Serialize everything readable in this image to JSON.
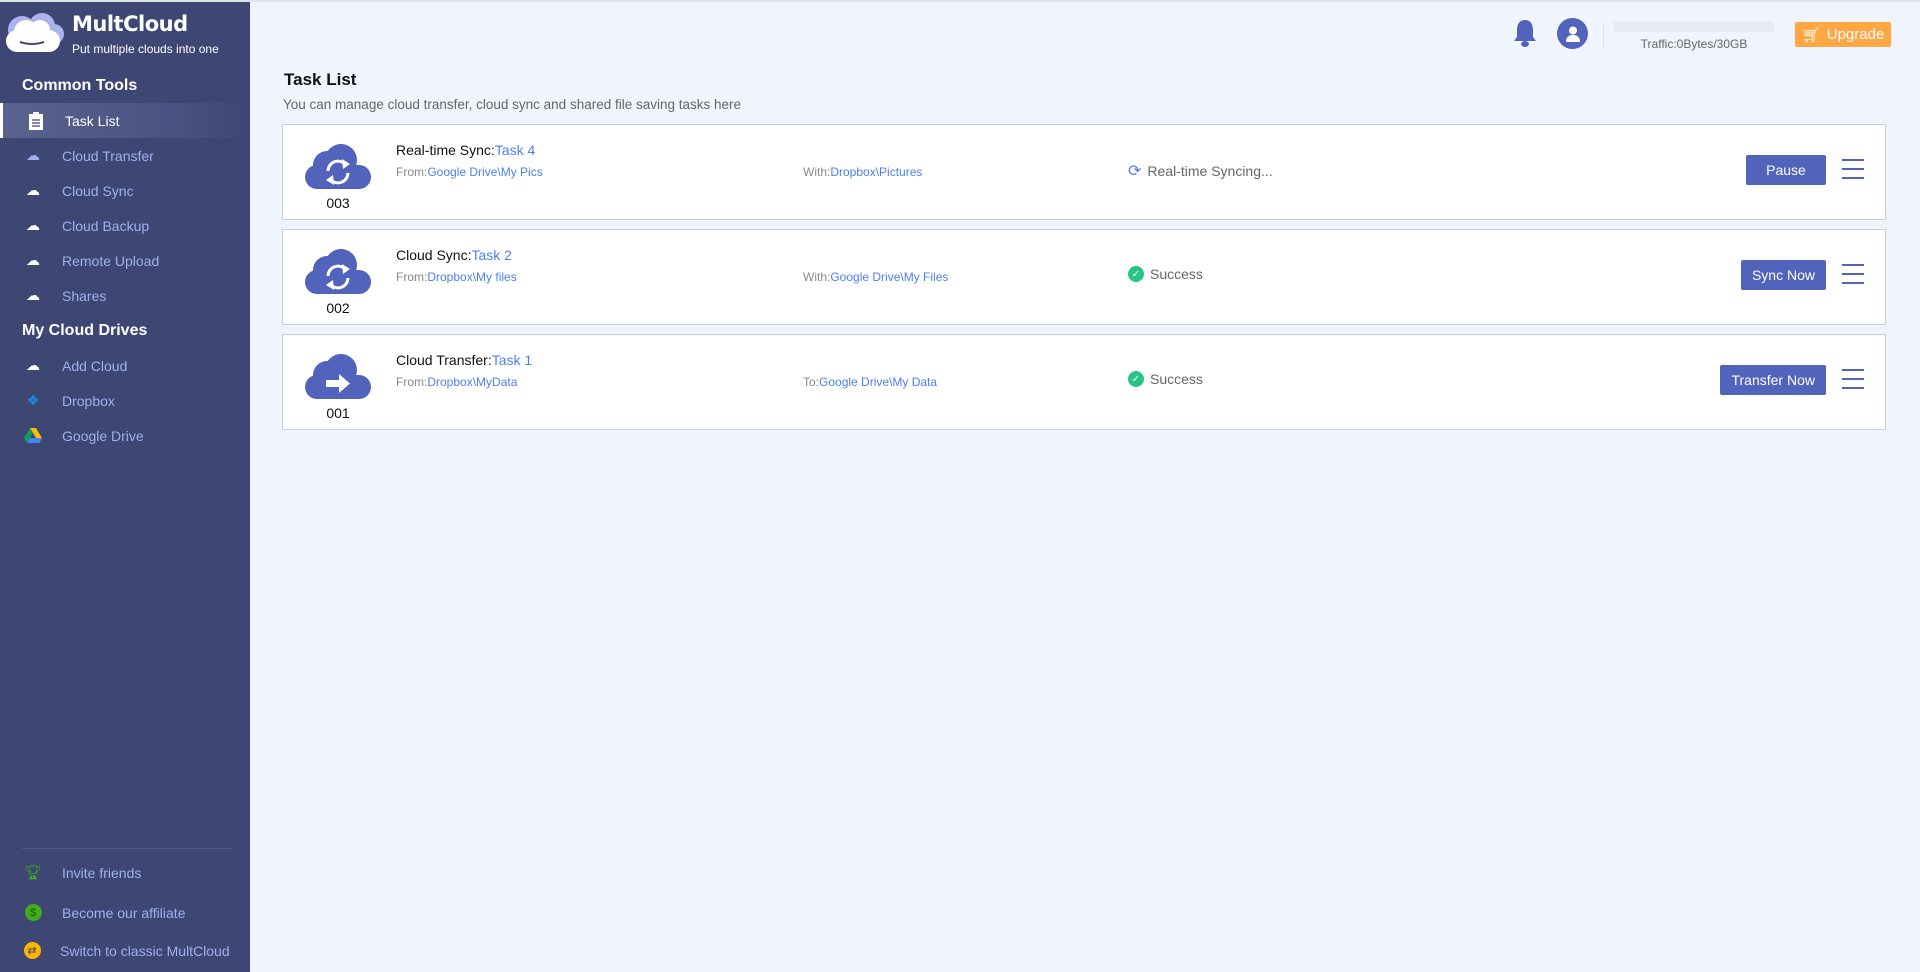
{
  "brand": {
    "name": "MultCloud",
    "tagline": "Put multiple clouds into one"
  },
  "sidebar": {
    "common_tools": "Common Tools",
    "tools": [
      {
        "label": "Task List",
        "icon": "clipboard-icon"
      },
      {
        "label": "Cloud Transfer",
        "icon": "cloud-transfer-icon"
      },
      {
        "label": "Cloud Sync",
        "icon": "cloud-sync-icon"
      },
      {
        "label": "Cloud Backup",
        "icon": "cloud-backup-icon"
      },
      {
        "label": "Remote Upload",
        "icon": "cloud-upload-icon"
      },
      {
        "label": "Shares",
        "icon": "cloud-share-icon"
      }
    ],
    "my_drives": "My Cloud Drives",
    "drives": [
      {
        "label": "Add Cloud"
      },
      {
        "label": "Dropbox"
      },
      {
        "label": "Google Drive"
      }
    ],
    "bottom": [
      {
        "label": "Invite friends"
      },
      {
        "label": "Become our affiliate"
      },
      {
        "label": "Switch to classic MultCloud"
      }
    ]
  },
  "header": {
    "traffic": "Traffic:0Bytes/30GB",
    "traffic_used_fraction": 0,
    "upgrade": "Upgrade"
  },
  "main": {
    "title": "Task List",
    "subtitle": "You can manage cloud transfer, cloud sync and shared file saving tasks here",
    "tasks": [
      {
        "num": "003",
        "type": "Real-time Sync:",
        "name": "Task 4",
        "from_label": "From:",
        "from": "Google Drive\\My Pics",
        "to_label": "With:",
        "to": "Dropbox\\Pictures",
        "status": "Real-time Syncing...",
        "action": "Pause"
      },
      {
        "num": "002",
        "type": "Cloud Sync:",
        "name": "Task 2",
        "from_label": "From:",
        "from": "Dropbox\\My files",
        "to_label": "With:",
        "to": "Google Drive\\My Files",
        "status": "Success",
        "action": "Sync Now"
      },
      {
        "num": "001",
        "type": "Cloud Transfer:",
        "name": "Task 1",
        "from_label": "From:",
        "from": "Dropbox\\MyData",
        "to_label": "To:",
        "to": "Google Drive\\My Data",
        "status": "Success",
        "action": "Transfer Now"
      }
    ]
  },
  "colors": {
    "sidebar": "#3e4674",
    "accent": "#5163ba",
    "link": "#4c7ff0",
    "upgrade": "#ffa744",
    "success": "#26c486"
  }
}
